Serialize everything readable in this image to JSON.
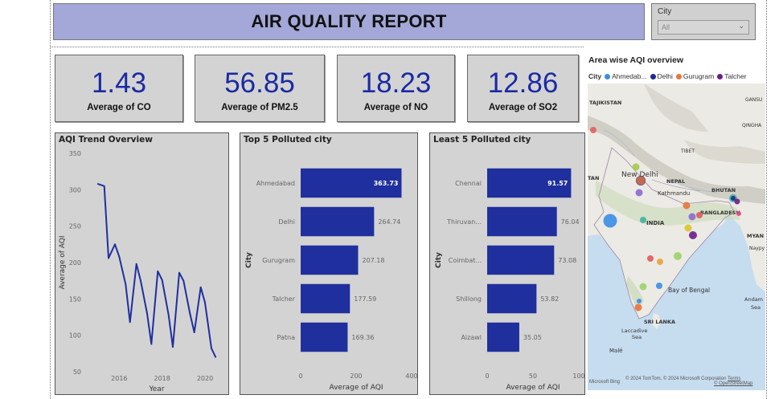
{
  "report": {
    "title": "AIR QUALITY REPORT"
  },
  "slicer": {
    "label": "City",
    "value": "All"
  },
  "cards": [
    {
      "value": "1.43",
      "caption": "Average of CO"
    },
    {
      "value": "56.85",
      "caption": "Average of PM2.5"
    },
    {
      "value": "18.23",
      "caption": "Average of NO"
    },
    {
      "value": "12.86",
      "caption": "Average of SO2"
    }
  ],
  "colors": {
    "bar": "#1f2f9e",
    "line": "#1f2f9e",
    "title_bg": "#a3a8d8",
    "card_value": "#1a2aa3"
  },
  "chart_data": [
    {
      "type": "line",
      "title": "AQI Trend Overview",
      "xlabel": "Year",
      "ylabel": "Average of AQI",
      "ylim": [
        50,
        350
      ],
      "yticks": [
        50,
        100,
        150,
        200,
        250,
        300,
        350
      ],
      "xticks": [
        2016,
        2018,
        2020
      ],
      "xlim": [
        2014.6,
        2020.9
      ],
      "x": [
        2015.0,
        2015.3,
        2015.5,
        2015.8,
        2016.0,
        2016.3,
        2016.5,
        2016.8,
        2017.0,
        2017.3,
        2017.5,
        2017.8,
        2018.0,
        2018.3,
        2018.5,
        2018.8,
        2019.0,
        2019.3,
        2019.5,
        2019.8,
        2020.0,
        2020.3,
        2020.5
      ],
      "values": [
        308,
        305,
        206,
        225,
        208,
        170,
        118,
        198,
        175,
        130,
        88,
        188,
        176,
        128,
        84,
        186,
        175,
        130,
        104,
        166,
        145,
        82,
        70
      ]
    },
    {
      "type": "bar",
      "title": "Top 5 Polluted city",
      "xlabel": "Average of AQI",
      "ylabel": "City",
      "xlim": [
        0,
        400
      ],
      "xticks": [
        0,
        200,
        400
      ],
      "categories": [
        "Ahmedabad",
        "Delhi",
        "Gurugram",
        "Talcher",
        "Patna"
      ],
      "values": [
        363.73,
        264.74,
        207.18,
        177.59,
        169.36
      ],
      "labels": [
        "363.73",
        "264.74",
        "207.18",
        "177.59",
        "169.36"
      ]
    },
    {
      "type": "bar",
      "title": "Least 5 Polluted city",
      "xlabel": "Average of AQI",
      "ylabel": "City",
      "xlim": [
        0,
        100
      ],
      "xticks": [
        0,
        50,
        100
      ],
      "categories": [
        "Chennai",
        "Thiruvan...",
        "Coimbat...",
        "Shillong",
        "Aizawl"
      ],
      "values": [
        91.57,
        76.04,
        73.08,
        53.82,
        35.05
      ],
      "labels": [
        "91.57",
        "76.04",
        "73.08",
        "53.82",
        "35.05"
      ]
    }
  ],
  "map": {
    "title": "Area wise AQI overview",
    "legend_title": "City",
    "legend": [
      {
        "name": "Ahmedab...",
        "color": "#3a8ee6"
      },
      {
        "name": "Delhi",
        "color": "#1d2b8f"
      },
      {
        "name": "Gurugram",
        "color": "#e8743b"
      },
      {
        "name": "Talcher",
        "color": "#6b1d8a"
      }
    ],
    "labels": [
      "TAJIKISTAN",
      "GANSU",
      "QINGHA",
      "TIBET",
      "New Delhi",
      "NEPAL",
      "Kathmandu",
      "BHUTAN",
      "BANGLADESH",
      "INDIA",
      "MYAN",
      "Naypy",
      "Bay of Bengal",
      "SRI LANKA",
      "Laccadive",
      "Sea",
      "Andam",
      "Sea",
      "Malé",
      "TAN"
    ],
    "bing": "Microsoft Bing",
    "copyright": "© 2024 TomTom, © 2024 Microsoft Corporation",
    "terms": "Terms",
    "osm": "© OpenStreetMap"
  }
}
